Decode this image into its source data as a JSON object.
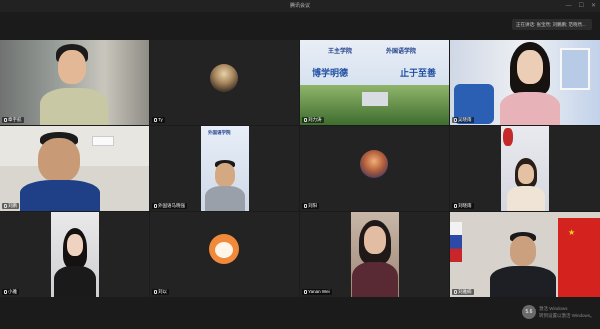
{
  "window": {
    "title": "腾讯会议"
  },
  "notice": {
    "text": "正在讲话: 张宝然; 刘鹏鹏; 范晓然..."
  },
  "tiles": [
    {
      "name": "章宇航"
    },
    {
      "name": "Ty"
    },
    {
      "name": "刘力涛"
    },
    {
      "name": "吴晓雨"
    },
    {
      "name": "刘鹏"
    },
    {
      "name": "外国语马晓强"
    },
    {
      "name": "刘阳"
    },
    {
      "name": "刘晓雨"
    },
    {
      "name": "小雅"
    },
    {
      "name": "刘以"
    },
    {
      "name": "Yanan Wei"
    },
    {
      "name": "刘雅楠"
    }
  ],
  "banner": {
    "left_logo": "王主学院",
    "right_logo": "外国语学院",
    "left_slogan": "博学明德",
    "right_slogan": "止于至善"
  },
  "watermark": {
    "badge": "5.6",
    "line1": "激活 Windows",
    "line2": "转到设置以激活 Windows。"
  },
  "colors": {
    "tile_bg": "#262626",
    "app_bg": "#1b1b1b",
    "banner_blue": "#1f4fa3"
  },
  "icons": [
    "mic-icon",
    "minimize-icon",
    "maximize-icon",
    "close-icon"
  ]
}
